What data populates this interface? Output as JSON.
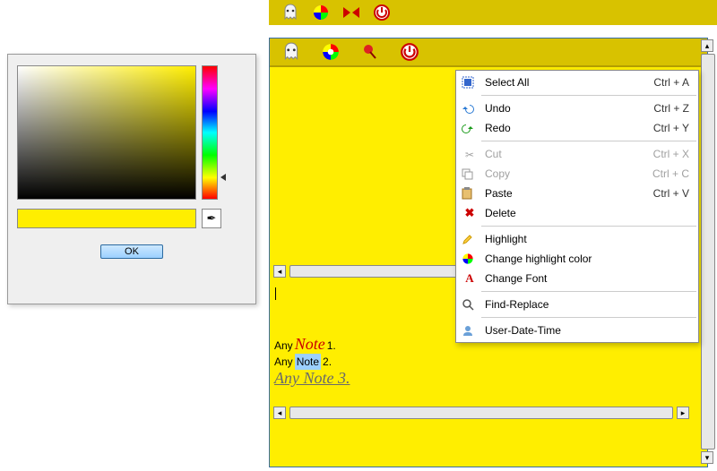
{
  "color_picker": {
    "ok_label": "OK",
    "base_hue": "#ffee00",
    "preview_color": "#ffee00"
  },
  "mini_toolbar": {
    "icons": [
      "ghost",
      "color-wheel",
      "bowtie",
      "power"
    ]
  },
  "note_toolbar": {
    "icons": [
      "ghost",
      "color-wheel",
      "pin",
      "power"
    ]
  },
  "note_body": {
    "line1_prefix": "Any",
    "line1_fancy": "Note",
    "line1_suffix": "1.",
    "line2_prefix": "Any",
    "line2_highlight": "Note",
    "line2_suffix": "2.",
    "line3_text": "Any Note 3."
  },
  "context_menu": {
    "items": [
      {
        "icon": "select-all",
        "label": "Select All",
        "shortcut": "Ctrl + A",
        "enabled": true
      },
      {
        "sep": true
      },
      {
        "icon": "undo",
        "label": "Undo",
        "shortcut": "Ctrl + Z",
        "enabled": true
      },
      {
        "icon": "redo",
        "label": "Redo",
        "shortcut": "Ctrl + Y",
        "enabled": true
      },
      {
        "sep": true
      },
      {
        "icon": "cut",
        "label": "Cut",
        "shortcut": "Ctrl + X",
        "enabled": false
      },
      {
        "icon": "copy",
        "label": "Copy",
        "shortcut": "Ctrl + C",
        "enabled": false
      },
      {
        "icon": "paste",
        "label": "Paste",
        "shortcut": "Ctrl + V",
        "enabled": true
      },
      {
        "icon": "delete",
        "label": "Delete",
        "shortcut": "",
        "enabled": true
      },
      {
        "sep": true
      },
      {
        "icon": "highlight",
        "label": "Highlight",
        "shortcut": "",
        "enabled": true
      },
      {
        "icon": "color-wheel",
        "label": "Change highlight color",
        "shortcut": "",
        "enabled": true
      },
      {
        "icon": "font",
        "label": "Change Font",
        "shortcut": "",
        "enabled": true
      },
      {
        "sep": true
      },
      {
        "icon": "find",
        "label": "Find-Replace",
        "shortcut": "",
        "enabled": true
      },
      {
        "sep": true
      },
      {
        "icon": "user",
        "label": "User-Date-Time",
        "shortcut": "",
        "enabled": true
      }
    ]
  }
}
